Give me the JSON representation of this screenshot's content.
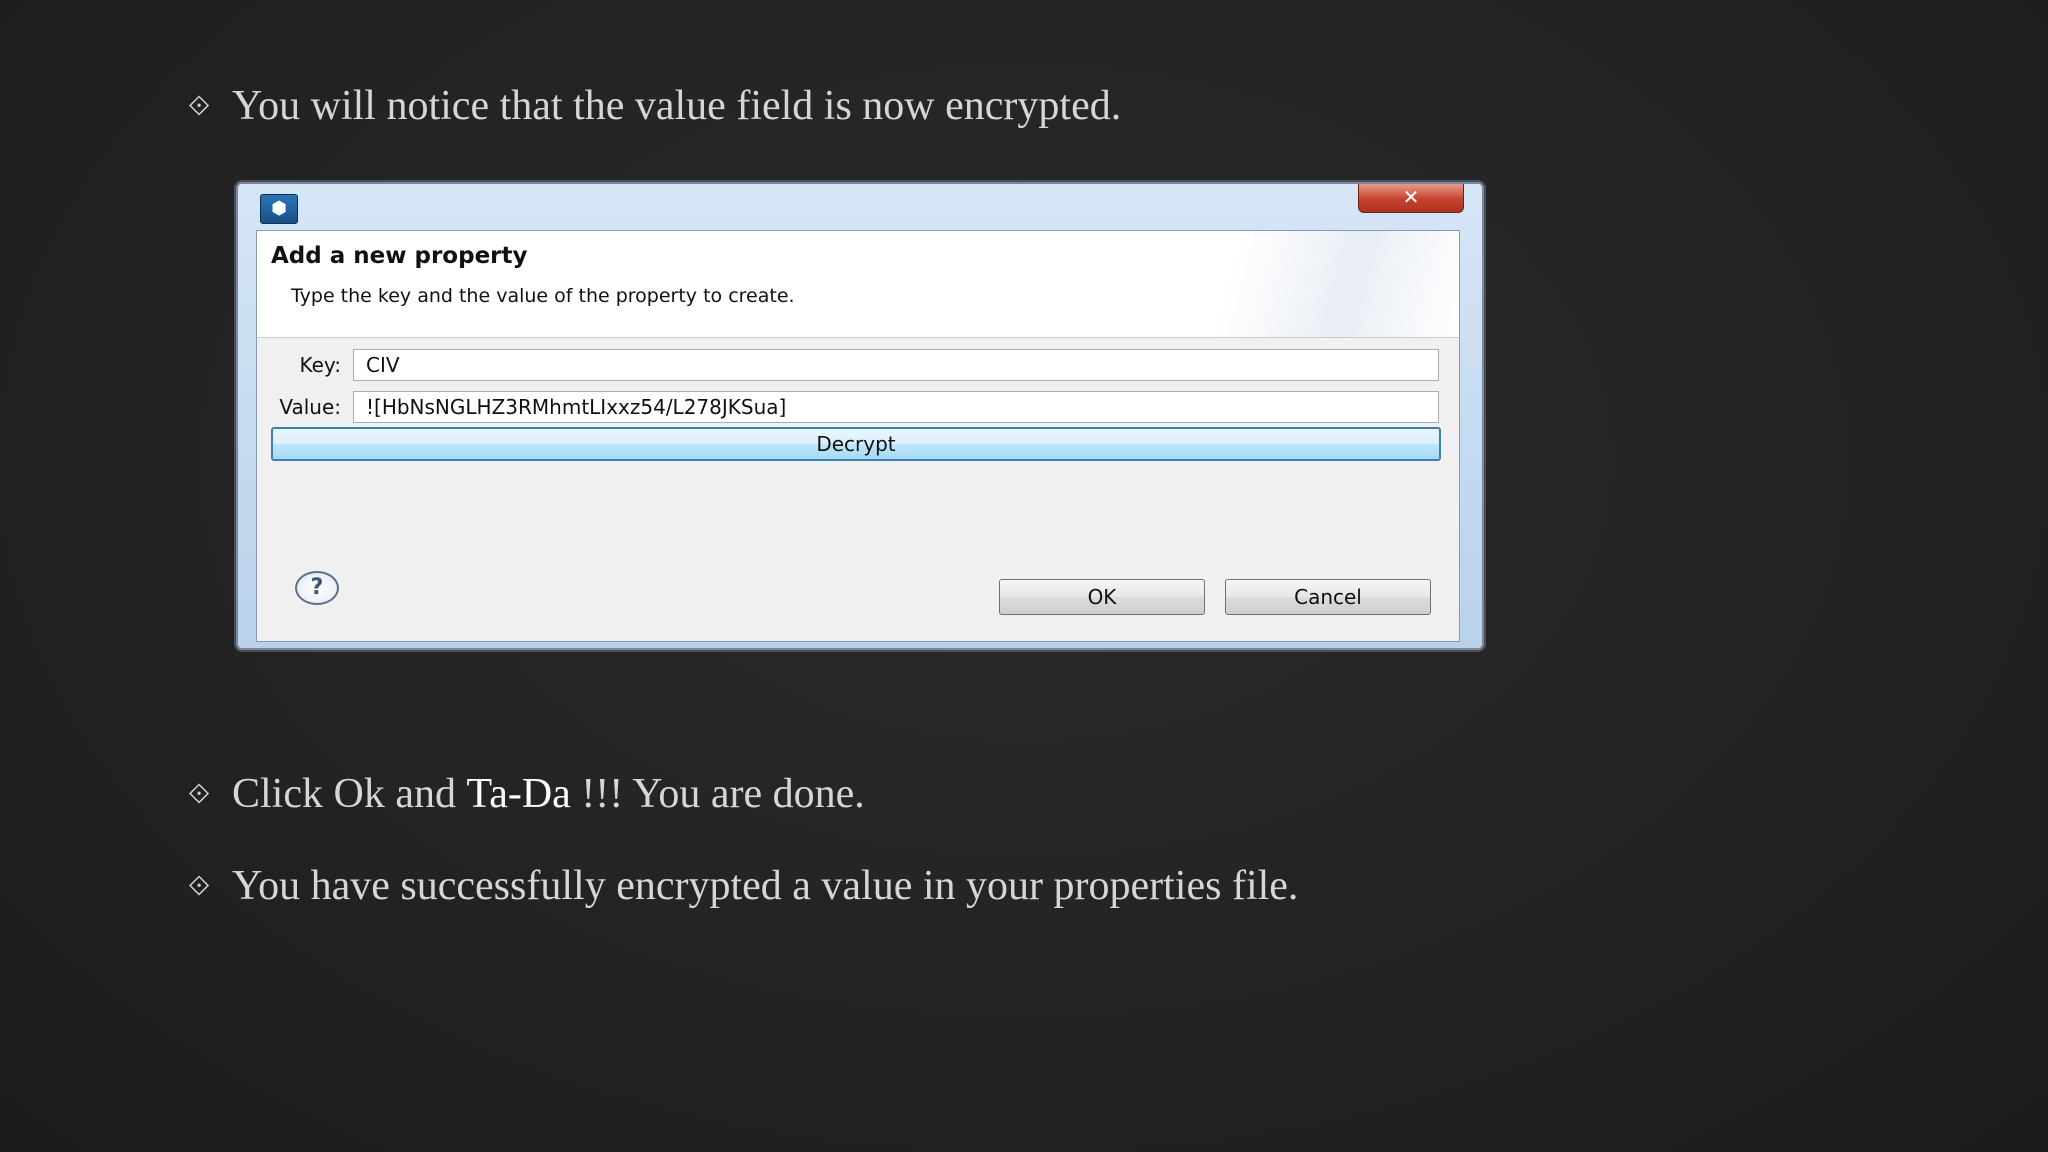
{
  "bullets": [
    {
      "marker": "⟐",
      "text": "You will notice that the value field is now encrypted."
    },
    {
      "marker": "⟐",
      "text_before": "Click Ok and ",
      "text_strong": "Ta-Da",
      "text_after": " !!! You are done."
    },
    {
      "marker": "⟐",
      "text": "You have successfully encrypted a value in your properties file."
    }
  ],
  "dialog": {
    "app_icon": "eclipse-app-icon",
    "close_glyph": "✕",
    "header_title": "Add a new property",
    "header_description": "Type the key and the value of the property to create.",
    "key_label": "Key:",
    "key_value": "CIV",
    "value_label": "Value:",
    "value_value": "![HbNsNGLHZ3RMhmtLIxxz54/L278JKSua]",
    "decrypt_label": "Decrypt",
    "help_glyph": "?",
    "ok_label": "OK",
    "cancel_label": "Cancel"
  },
  "colors": {
    "background": "#232325",
    "slide_text": "#d6d6d6",
    "close_button": "#c4432f",
    "decrypt_border": "#3c7fb1"
  }
}
